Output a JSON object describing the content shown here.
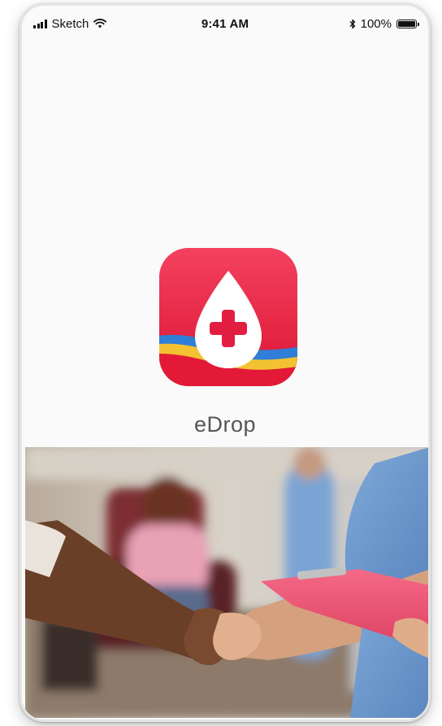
{
  "status_bar": {
    "carrier": "Sketch",
    "time": "9:41 AM",
    "battery_percent": "100%",
    "icons": [
      "signal-bars-icon",
      "wifi-icon",
      "bluetooth-icon",
      "battery-icon"
    ]
  },
  "app": {
    "name": "eDrop",
    "icon": "blood-drop-medical-cross-icon",
    "brand_color": "#e8203f"
  },
  "hero_image": {
    "subject": "handshake-photo"
  }
}
